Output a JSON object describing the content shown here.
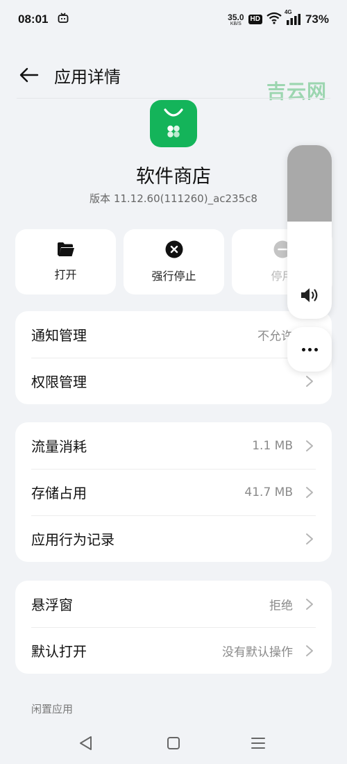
{
  "status_bar": {
    "time": "08:01",
    "net_speed_value": "35.0",
    "net_speed_unit": "KB/S",
    "hd_badge": "HD",
    "cell_badge": "4G",
    "battery": "73%"
  },
  "header": {
    "title": "应用详情"
  },
  "watermark": "吉云网",
  "app": {
    "name": "软件商店",
    "version": "版本 11.12.60(111260)_ac235c8",
    "icon_color": "#14b45a"
  },
  "actions": {
    "open": "打开",
    "force_stop": "强行停止",
    "disable": "停用"
  },
  "card_notifications": {
    "notification_label": "通知管理",
    "notification_value": "不允许",
    "permission_label": "权限管理"
  },
  "card_usage": {
    "data_label": "流量消耗",
    "data_value": "1.1 MB",
    "storage_label": "存储占用",
    "storage_value": "41.7 MB",
    "behavior_label": "应用行为记录"
  },
  "card_defaults": {
    "float_label": "悬浮窗",
    "float_value": "拒绝",
    "default_open_label": "默认打开",
    "default_open_value": "没有默认操作"
  },
  "section_idle": "闲置应用",
  "volume": {
    "level_fraction": 0.56
  }
}
